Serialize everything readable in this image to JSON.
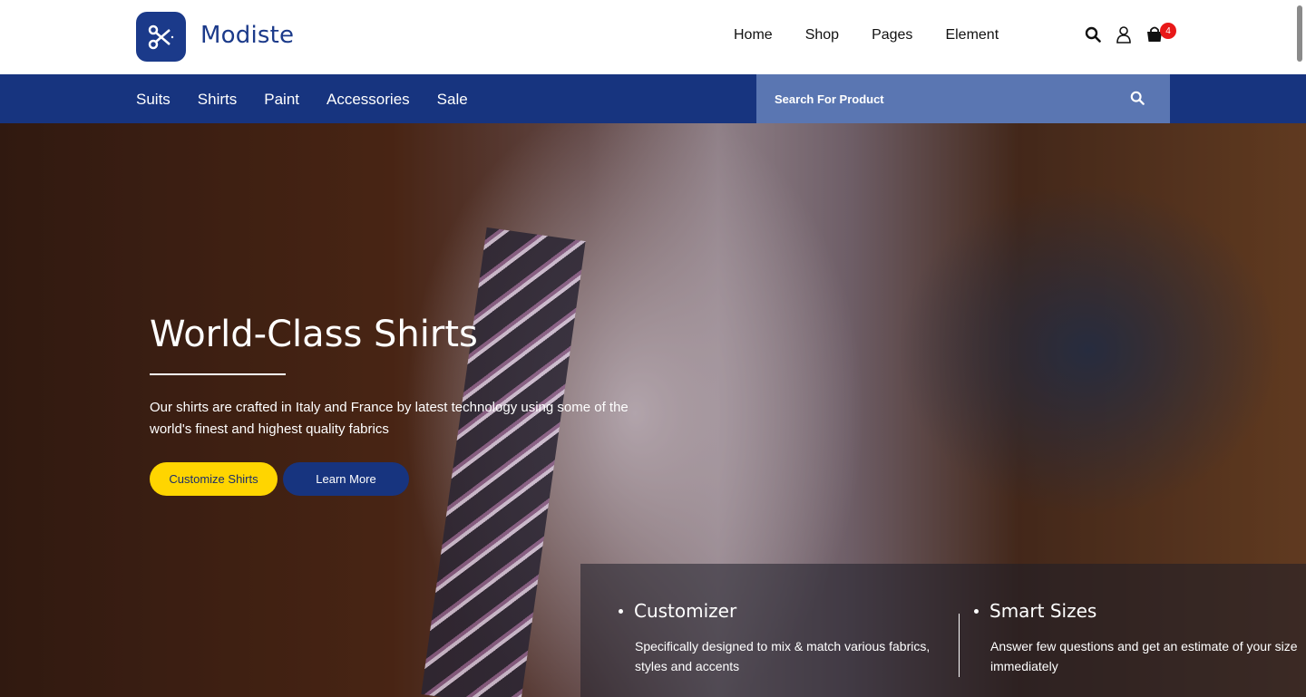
{
  "brand": {
    "name": "Modiste"
  },
  "nav": {
    "items": [
      "Home",
      "Shop",
      "Pages",
      "Element"
    ]
  },
  "header_icons": {
    "search": "search-icon",
    "user": "user-icon",
    "cart": "cart-icon",
    "cart_count": "4"
  },
  "categories": [
    "Suits",
    "Shirts",
    "Paint",
    "Accessories",
    "Sale"
  ],
  "search": {
    "placeholder": "Search For Product"
  },
  "hero": {
    "title": "World-Class Shirts",
    "text": "Our shirts are crafted in Italy and France by latest technology using some of the world's finest and highest quality fabrics",
    "primary_button": "Customize Shirts",
    "secondary_button": "Learn More"
  },
  "features": [
    {
      "title": "Customizer",
      "text": "Specifically designed to mix & match various fabrics, styles and accents"
    },
    {
      "title": "Smart Sizes",
      "text": "Answer few questions and get an estimate of your size immediately"
    }
  ],
  "colors": {
    "primary": "#17347f",
    "accent": "#ffd500",
    "badge": "#e81818",
    "search_bg": "#5a76b2"
  }
}
